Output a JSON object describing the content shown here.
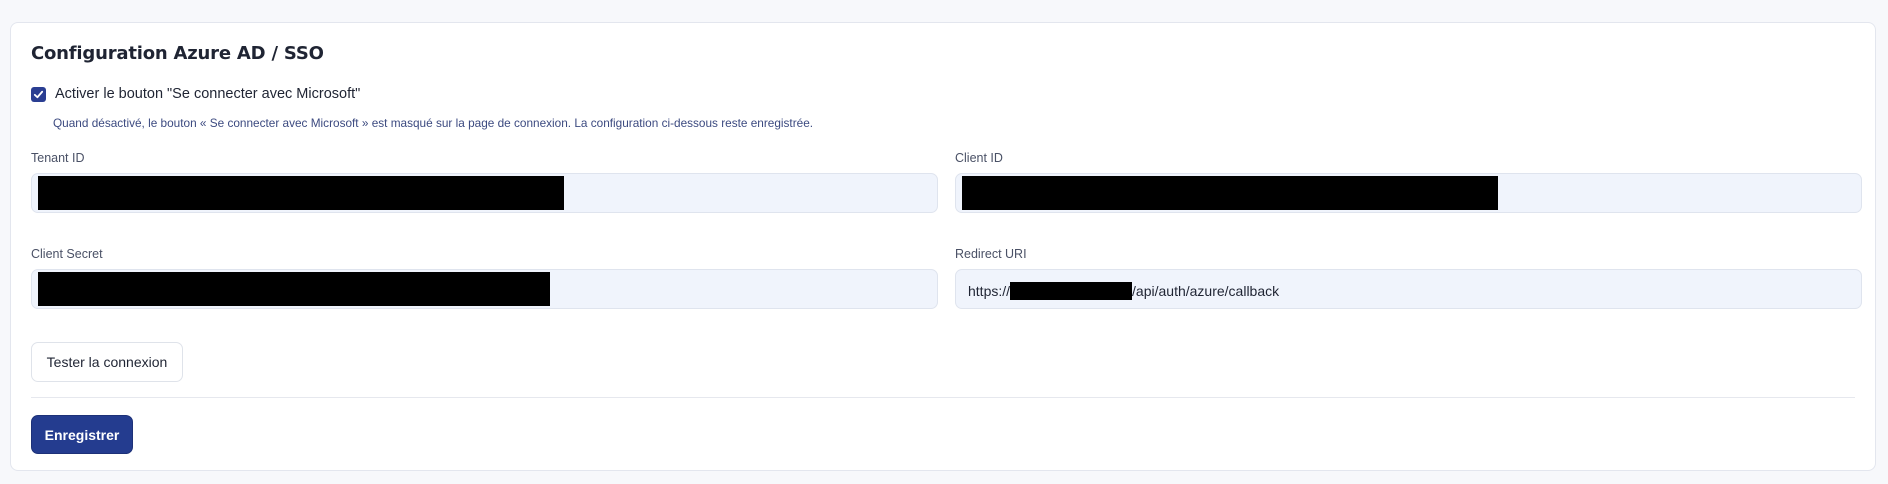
{
  "section": {
    "title": "Configuration Azure AD / SSO"
  },
  "toggle": {
    "label": "Activer le bouton \"Se connecter avec Microsoft\"",
    "checked": true,
    "hint": "Quand désactivé, le bouton « Se connecter avec Microsoft » est masqué sur la page de connexion. La configuration ci-dessous reste enregistrée."
  },
  "fields": {
    "tenant_id": {
      "label": "Tenant ID",
      "value": ""
    },
    "client_id": {
      "label": "Client ID",
      "value": ""
    },
    "client_secret": {
      "label": "Client Secret",
      "value": ""
    },
    "redirect_uri": {
      "label": "Redirect URI",
      "value_prefix": "https://",
      "value_suffix": "/api/auth/azure/callback"
    }
  },
  "actions": {
    "test_label": "Tester la connexion",
    "save_label": "Enregistrer"
  },
  "colors": {
    "accent": "#243c8f",
    "field_bg": "#f0f4fc",
    "hint_text": "#3c4a80"
  }
}
